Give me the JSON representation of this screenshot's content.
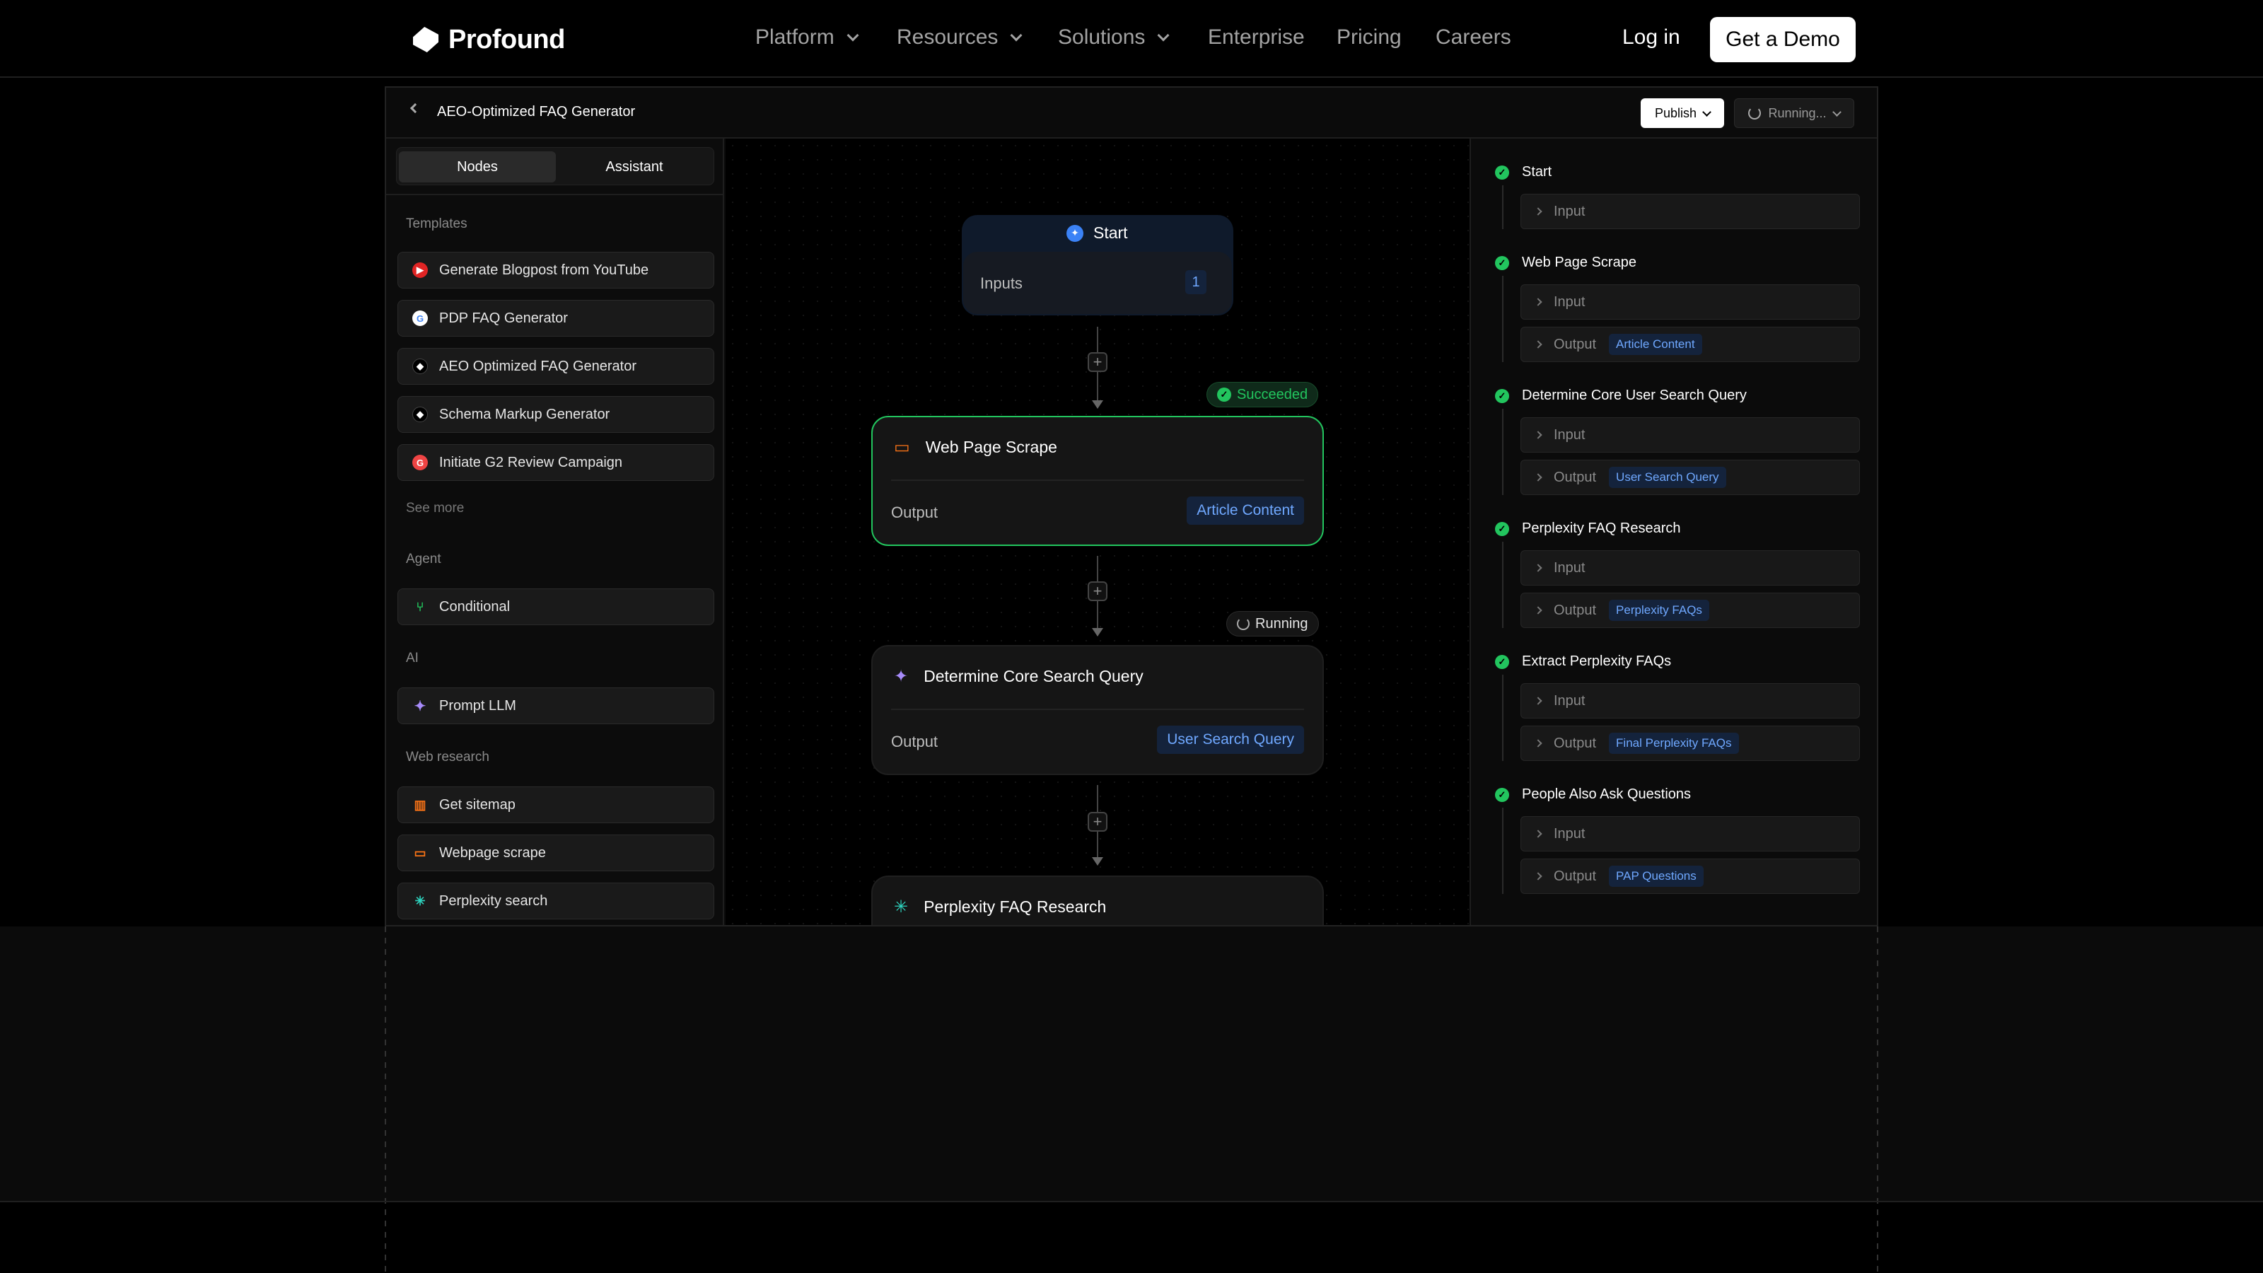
{
  "nav": {
    "brand": "Profound",
    "items": [
      "Platform",
      "Resources",
      "Solutions",
      "Enterprise",
      "Pricing",
      "Careers"
    ],
    "login": "Log in",
    "demo": "Get a Demo"
  },
  "workflow": {
    "title": "AEO-Optimized FAQ Generator",
    "publish": "Publish",
    "status": "Running..."
  },
  "left_panel": {
    "tabs": [
      "Nodes",
      "Assistant"
    ],
    "templates_header": "Templates",
    "templates": [
      {
        "label": "Generate Blogpost from YouTube",
        "icon": "youtube-icon"
      },
      {
        "label": "PDP FAQ Generator",
        "icon": "google-icon"
      },
      {
        "label": "AEO Optimized FAQ Generator",
        "icon": "profound-icon"
      },
      {
        "label": "Schema Markup Generator",
        "icon": "profound-icon"
      },
      {
        "label": "Initiate G2 Review Campaign",
        "icon": "g2-icon"
      }
    ],
    "see_more": "See more",
    "agent_header": "Agent",
    "agent_items": [
      {
        "label": "Conditional",
        "icon": "branch-icon"
      }
    ],
    "ai_header": "AI",
    "ai_items": [
      {
        "label": "Prompt LLM",
        "icon": "sparkle-icon"
      }
    ],
    "web_header": "Web research",
    "web_items": [
      {
        "label": "Get sitemap",
        "icon": "map-icon"
      },
      {
        "label": "Webpage scrape",
        "icon": "monitor-icon"
      },
      {
        "label": "Perplexity search",
        "icon": "perplexity-icon"
      }
    ]
  },
  "canvas": {
    "start": {
      "label": "Start",
      "inputs_label": "Inputs",
      "inputs_count": "1"
    },
    "nodes": [
      {
        "title": "Web Page Scrape",
        "output_label": "Output",
        "output": "Article Content",
        "status": "Succeeded"
      },
      {
        "title": "Determine Core Search Query",
        "output_label": "Output",
        "output": "User Search Query",
        "status": "Running"
      },
      {
        "title": "Perplexity FAQ Research"
      }
    ]
  },
  "right_panel": {
    "steps": [
      {
        "title": "Start",
        "rows": [
          {
            "label": "Input"
          }
        ]
      },
      {
        "title": "Web Page Scrape",
        "rows": [
          {
            "label": "Input"
          },
          {
            "label": "Output",
            "chip": "Article Content"
          }
        ]
      },
      {
        "title": "Determine Core User Search Query",
        "rows": [
          {
            "label": "Input"
          },
          {
            "label": "Output",
            "chip": "User Search Query"
          }
        ]
      },
      {
        "title": "Perplexity FAQ Research",
        "rows": [
          {
            "label": "Input"
          },
          {
            "label": "Output",
            "chip": "Perplexity FAQs"
          }
        ]
      },
      {
        "title": "Extract Perplexity FAQs",
        "rows": [
          {
            "label": "Input"
          },
          {
            "label": "Output",
            "chip": "Final Perplexity FAQs"
          }
        ]
      },
      {
        "title": "People Also Ask Questions",
        "rows": [
          {
            "label": "Input"
          },
          {
            "label": "Output",
            "chip": "PAP Questions"
          }
        ]
      }
    ]
  },
  "colors": {
    "success": "#22c55e",
    "accent_blue": "#6fa8ff",
    "chip_bg": "#14233c"
  }
}
